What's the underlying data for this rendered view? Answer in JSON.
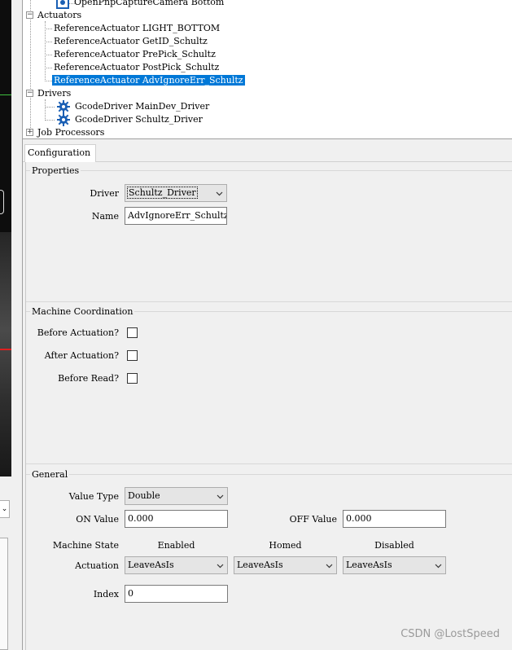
{
  "tree": {
    "top_item": "OpenPnpCaptureCamera Bottom",
    "actuators_label": "Actuators",
    "actuators": [
      "ReferenceActuator LIGHT_BOTTOM",
      "ReferenceActuator GetID_Schultz",
      "ReferenceActuator PrePick_Schultz",
      "ReferenceActuator PostPick_Schultz",
      "ReferenceActuator AdvIgnoreErr_Schultz"
    ],
    "drivers_label": "Drivers",
    "drivers": [
      "GcodeDriver MainDev_Driver",
      "GcodeDriver Schultz_Driver"
    ],
    "job_processors_label": "Job Processors",
    "expanded_glyph": "−",
    "collapsed_glyph": "+"
  },
  "tab_label": "Configuration",
  "properties": {
    "title": "Properties",
    "driver_label": "Driver",
    "driver_value": "Schultz_Driver",
    "name_label": "Name",
    "name_value": "AdvIgnoreErr_Schultz"
  },
  "coordination": {
    "title": "Machine Coordination",
    "before_actuation_label": "Before Actuation?",
    "after_actuation_label": "After Actuation?",
    "before_read_label": "Before Read?",
    "before_actuation_checked": false,
    "after_actuation_checked": false,
    "before_read_checked": false
  },
  "general": {
    "title": "General",
    "value_type_label": "Value Type",
    "value_type": "Double",
    "on_value_label": "ON Value",
    "on_value": "0.000",
    "off_value_label": "OFF Value",
    "off_value": "0.000",
    "machine_state_label": "Machine State",
    "col_enabled": "Enabled",
    "col_homed": "Homed",
    "col_disabled": "Disabled",
    "actuation_label": "Actuation",
    "actuation_enabled": "LeaveAsIs",
    "actuation_homed": "LeaveAsIs",
    "actuation_disabled": "LeaveAsIs",
    "index_label": "Index",
    "index_value": "0"
  },
  "left_pane": {
    "dropdown_glyph": "⌄"
  },
  "watermark": "CSDN @LostSpeed",
  "colors": {
    "selection": "#0078d7",
    "gear": "#1a5fb4"
  }
}
